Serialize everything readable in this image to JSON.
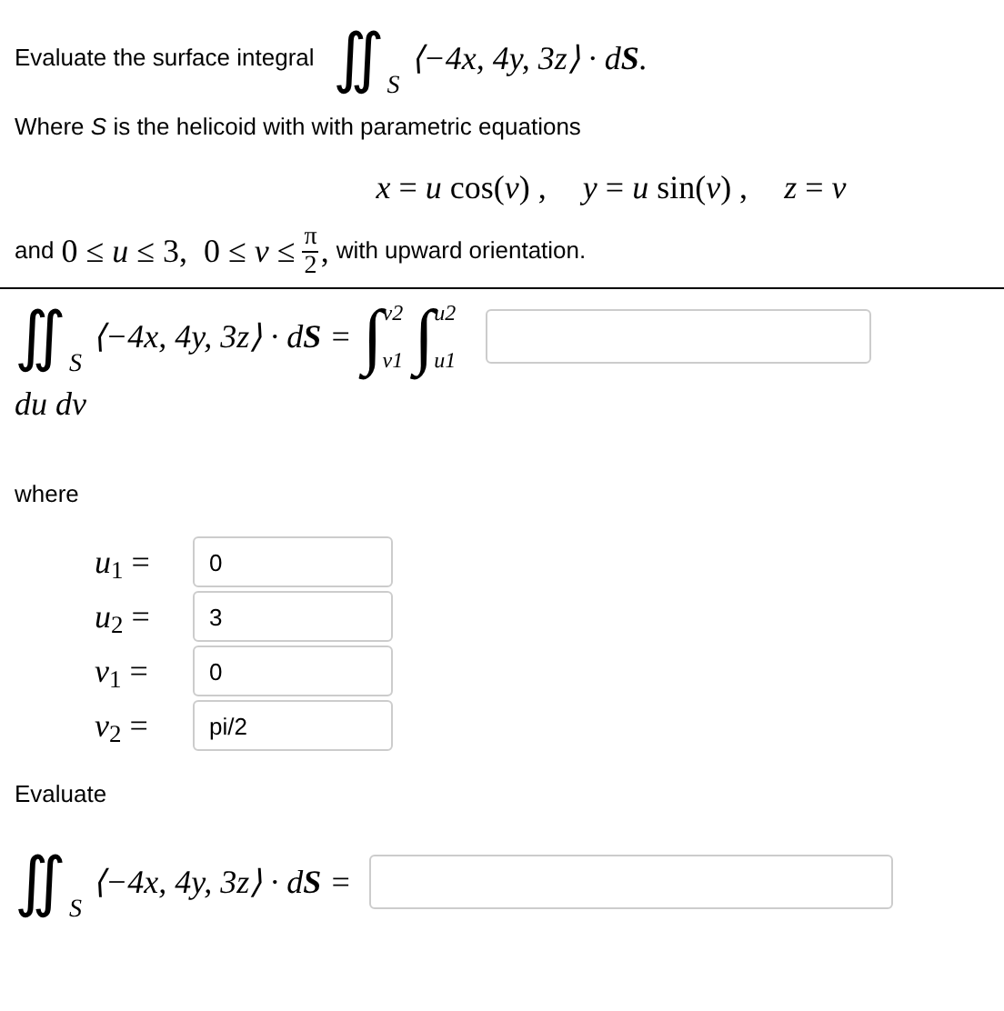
{
  "intro": {
    "lead": "Evaluate the surface integral",
    "integral": "∬",
    "domain": "S",
    "integrand": "⟨−4x, 4y, 3z⟩ · d**S**."
  },
  "surface": {
    "text": "Where *S* is the helicoid with with parametric equations",
    "equations": [
      "*x* = *u* cos(*v*) ,",
      "*y* = *u* sin(*v*) ,",
      "*z* = *v*"
    ]
  },
  "bounds": {
    "lead": "and",
    "range": "0 ≤ *u* ≤ 3,  0 ≤ *v* ≤",
    "numerator": "π",
    "denominator": "2",
    "comma": ",",
    "tail": "with upward orientation."
  },
  "setup": {
    "integral": "∬",
    "domain": "S",
    "integrand": "⟨−4x, 4y, 3z⟩ · d**S** =",
    "outer": {
      "sign": "∫",
      "upper": "v2",
      "lower": "v1"
    },
    "inner": {
      "sign": "∫",
      "upper": "u2",
      "lower": "u1"
    },
    "differentials": "*du dv*"
  },
  "where_label": "where",
  "limits": [
    {
      "label": "*u*$_{1}$ =",
      "value": "0"
    },
    {
      "label": "*u*$_{2}$ =",
      "value": "3"
    },
    {
      "label": "*v*$_{1}$ =",
      "value": "0"
    },
    {
      "label": "*v*$_{2}$ =",
      "value": "pi/2"
    }
  ],
  "evaluate_label": "Evaluate",
  "final": {
    "integral": "∬",
    "domain": "S",
    "integrand": "⟨−4x, 4y, 3z⟩ · d**S** ="
  }
}
